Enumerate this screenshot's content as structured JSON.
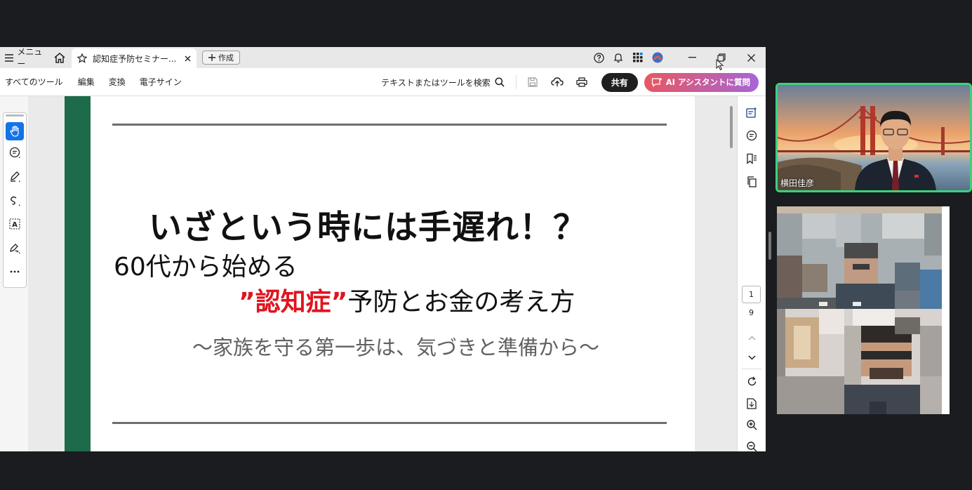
{
  "titlebar": {
    "menu_label": "メニュー",
    "tab_title": "認知症予防セミナー...",
    "create_label": "作成"
  },
  "toolbar": {
    "all_tools": "すべてのツール",
    "edit": "編集",
    "convert": "変換",
    "esign": "電子サイン",
    "search_placeholder": "テキストまたはツールを検索",
    "share": "共有",
    "ai_assistant": "AI アシスタントに質問"
  },
  "slide": {
    "title": "いざという時には手遅れ！？",
    "line2": "60代から始める",
    "line3_red": "”認知症”",
    "line3_rest": "予防とお金の考え方",
    "subtitle": "～家族を守る第一歩は、気づきと準備から～"
  },
  "navigation": {
    "current_page": "1",
    "total_pages": "9"
  },
  "video": {
    "host_name": "横田佳彦"
  },
  "colors": {
    "accent": "#1473e6",
    "slide_band": "#1e6b4a",
    "highlight_red": "#e0141e",
    "speaker_border": "#3ad27c"
  }
}
